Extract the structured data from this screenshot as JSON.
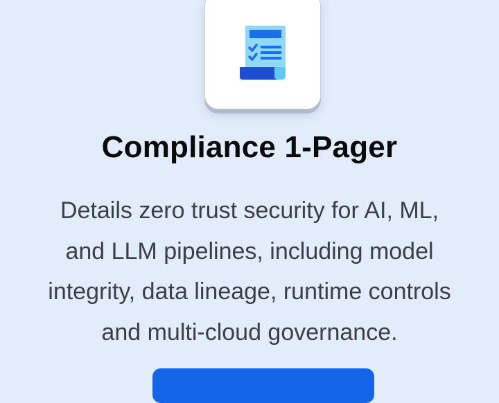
{
  "card": {
    "icon": "compliance-document-icon",
    "title": "Compliance 1-Pager",
    "description_lines": [
      "Details zero trust security for AI, ML,",
      "and LLM pipelines, including model",
      "integrity, data lineage, runtime controls",
      "and multi-cloud governance."
    ],
    "button_label": ""
  },
  "colors": {
    "background": "#e2ecfb",
    "icon_light_blue": "#5fc6f6",
    "icon_dark_blue": "#1b57d6",
    "button_blue": "#1565e8"
  }
}
